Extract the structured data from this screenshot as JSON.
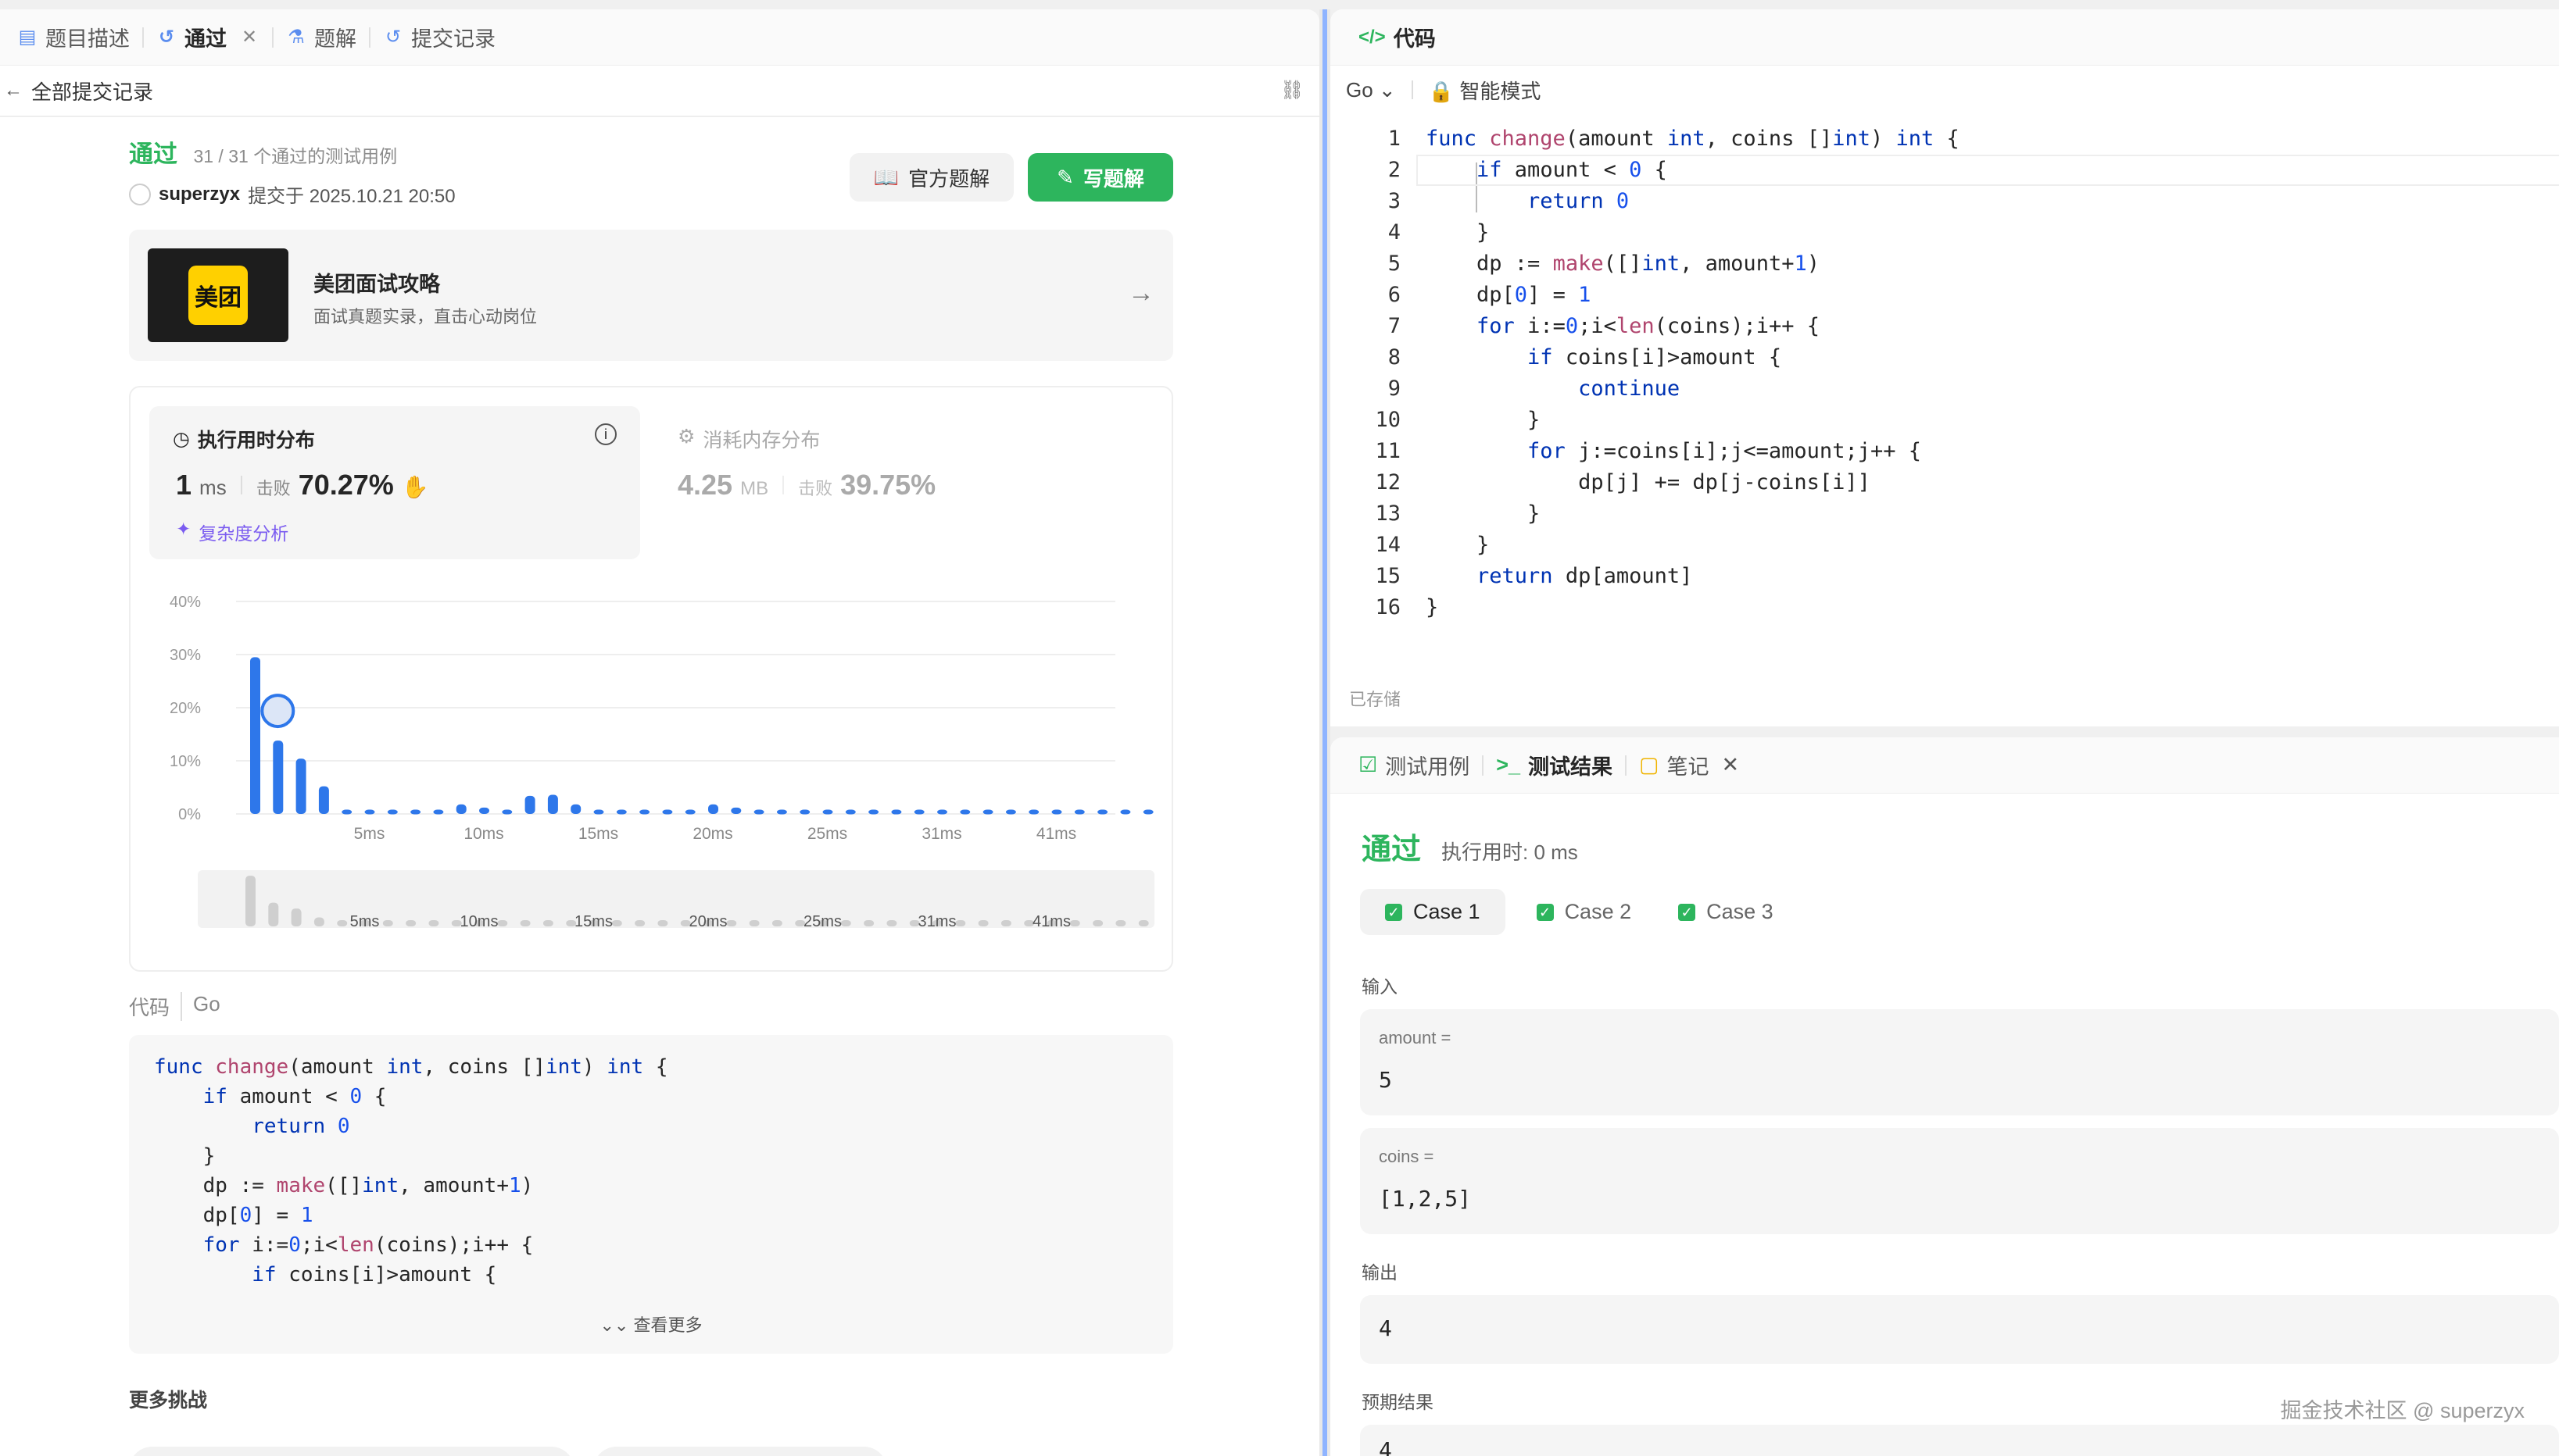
{
  "left_tabs": [
    "题目描述",
    "通过",
    "题解",
    "提交记录"
  ],
  "back_label": "全部提交记录",
  "result": {
    "status": "通过",
    "cases": "31 / 31 个通过的测试用例",
    "user": "superzyx",
    "submitted": "提交于 2025.10.21 20:50"
  },
  "buttons": {
    "official": "官方题解",
    "write": "写题解"
  },
  "promo": {
    "logo": "美团",
    "title": "美团面试攻略",
    "subtitle": "面试真题实录，直击心动岗位"
  },
  "stats": {
    "runtime_title": "执行用时分布",
    "runtime_value": "1",
    "runtime_unit": "ms",
    "beat_label": "击败",
    "runtime_beat": "70.27%",
    "complexity": "复杂度分析",
    "memory_title": "消耗内存分布",
    "memory_value": "4.25",
    "memory_unit": "MB",
    "memory_beat": "39.75%"
  },
  "chart_data": {
    "type": "bar",
    "y_ticks": [
      "40%",
      "30%",
      "20%",
      "10%",
      "0%"
    ],
    "x_ticks": [
      "5ms",
      "10ms",
      "15ms",
      "20ms",
      "25ms",
      "31ms",
      "41ms"
    ],
    "ylim": [
      0,
      40
    ],
    "values": [
      29.5,
      13.8,
      10.4,
      5.2,
      0.8,
      0.8,
      0.8,
      0.8,
      0.8,
      1.8,
      1.2,
      0.8,
      3.4,
      3.6,
      1.8,
      0.8,
      0.8,
      0.8,
      0.8,
      0.8,
      1.8,
      1.2,
      0.8,
      0.8,
      0.8,
      0.8,
      0.8,
      0.8,
      0.8,
      0.8,
      0.8,
      0.8,
      0.8,
      0.8,
      0.8,
      0.8,
      0.8,
      0.8,
      0.8,
      0.8
    ],
    "highlight_value": 19.4
  },
  "code_section": {
    "label": "代码",
    "lang": "Go",
    "more": "查看更多"
  },
  "more_title": "更多挑战",
  "left_code": [
    [
      [
        "kw",
        "func "
      ],
      [
        "fn",
        "change"
      ],
      [
        "p",
        "(amount "
      ],
      [
        "ty",
        "int"
      ],
      [
        "p",
        ", coins []"
      ],
      [
        "ty",
        "int"
      ],
      [
        "p",
        ") "
      ],
      [
        "ty",
        "int"
      ],
      [
        "p",
        " {"
      ]
    ],
    [
      [
        "p",
        "    "
      ],
      [
        "kw",
        "if"
      ],
      [
        "p",
        " amount < "
      ],
      [
        "num",
        "0"
      ],
      [
        "p",
        " {"
      ]
    ],
    [
      [
        "p",
        "        "
      ],
      [
        "kw",
        "return "
      ],
      [
        "num",
        "0"
      ]
    ],
    [
      [
        "p",
        "    }"
      ]
    ],
    [
      [
        "p",
        "    dp := "
      ],
      [
        "fn",
        "make"
      ],
      [
        "p",
        "([]"
      ],
      [
        "ty",
        "int"
      ],
      [
        "p",
        ", amount+"
      ],
      [
        "num",
        "1"
      ],
      [
        "p",
        ")"
      ]
    ],
    [
      [
        "p",
        "    dp["
      ],
      [
        "num",
        "0"
      ],
      [
        "p",
        "] = "
      ],
      [
        "num",
        "1"
      ]
    ],
    [
      [
        "p",
        "    "
      ],
      [
        "kw",
        "for"
      ],
      [
        "p",
        " i:="
      ],
      [
        "num",
        "0"
      ],
      [
        "p",
        ";i<"
      ],
      [
        "fn",
        "len"
      ],
      [
        "p",
        "(coins);i++ {"
      ]
    ],
    [
      [
        "p",
        "        "
      ],
      [
        "kw",
        "if"
      ],
      [
        "p",
        " coins[i]>amount {"
      ]
    ]
  ],
  "editor": {
    "title": "代码",
    "lang": "Go",
    "mode": "智能模式",
    "saved": "已存储"
  },
  "editor_code": [
    [
      [
        "kw",
        "func "
      ],
      [
        "fn",
        "change"
      ],
      [
        "p",
        "(amount "
      ],
      [
        "ty",
        "int"
      ],
      [
        "p",
        ", coins []"
      ],
      [
        "ty",
        "int"
      ],
      [
        "p",
        ") "
      ],
      [
        "ty",
        "int"
      ],
      [
        "p",
        " {"
      ]
    ],
    [
      [
        "p",
        "    "
      ],
      [
        "kw",
        "if"
      ],
      [
        "p",
        " amount < "
      ],
      [
        "num",
        "0"
      ],
      [
        "p",
        " {"
      ]
    ],
    [
      [
        "p",
        "        "
      ],
      [
        "kw",
        "return "
      ],
      [
        "num",
        "0"
      ]
    ],
    [
      [
        "p",
        "    }"
      ]
    ],
    [
      [
        "p",
        "    dp := "
      ],
      [
        "fn",
        "make"
      ],
      [
        "p",
        "([]"
      ],
      [
        "ty",
        "int"
      ],
      [
        "p",
        ", amount+"
      ],
      [
        "num",
        "1"
      ],
      [
        "p",
        ")"
      ]
    ],
    [
      [
        "p",
        "    dp["
      ],
      [
        "num",
        "0"
      ],
      [
        "p",
        "] = "
      ],
      [
        "num",
        "1"
      ]
    ],
    [
      [
        "p",
        "    "
      ],
      [
        "kw",
        "for"
      ],
      [
        "p",
        " i:="
      ],
      [
        "num",
        "0"
      ],
      [
        "p",
        ";i<"
      ],
      [
        "fn",
        "len"
      ],
      [
        "p",
        "(coins);i++ {"
      ]
    ],
    [
      [
        "p",
        "        "
      ],
      [
        "kw",
        "if"
      ],
      [
        "p",
        " coins[i]>amount {"
      ]
    ],
    [
      [
        "p",
        "            "
      ],
      [
        "kw",
        "continue"
      ]
    ],
    [
      [
        "p",
        "        }"
      ]
    ],
    [
      [
        "p",
        "        "
      ],
      [
        "kw",
        "for"
      ],
      [
        "p",
        " j:=coins[i];j<=amount;j++ {"
      ]
    ],
    [
      [
        "p",
        "            dp[j] += dp[j-coins[i]]"
      ]
    ],
    [
      [
        "p",
        "        }"
      ]
    ],
    [
      [
        "p",
        "    }"
      ]
    ],
    [
      [
        "p",
        "    "
      ],
      [
        "kw",
        "return"
      ],
      [
        "p",
        " dp[amount]"
      ]
    ],
    [
      [
        "p",
        "}"
      ]
    ]
  ],
  "bottom_tabs": [
    "测试用例",
    "测试结果",
    "笔记"
  ],
  "test": {
    "status": "通过",
    "runtime": "执行用时: 0 ms",
    "cases": [
      "Case 1",
      "Case 2",
      "Case 3"
    ],
    "input_label": "输入",
    "amount_label": "amount =",
    "amount_value": "5",
    "coins_label": "coins =",
    "coins_value": "[1,2,5]",
    "output_label": "输出",
    "output_value": "4",
    "expected_label": "预期结果",
    "expected_value": "4"
  },
  "watermark": "掘金技术社区 @ superzyx"
}
